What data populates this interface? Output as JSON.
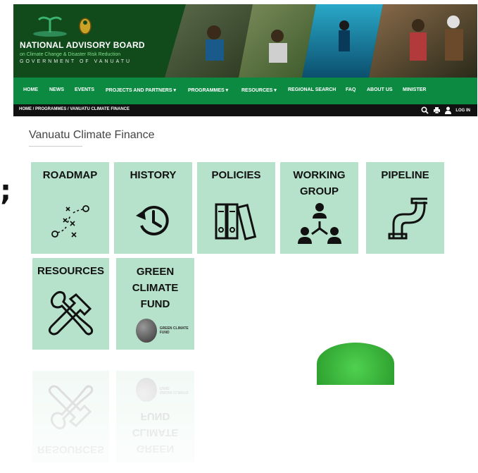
{
  "header": {
    "org_title": "NATIONAL ADVISORY BOARD",
    "org_subtitle": "on Climate Change & Disaster Risk Reduction",
    "org_gov": "GOVERNMENT OF VANUATU"
  },
  "nav": {
    "items": [
      {
        "label": "HOME"
      },
      {
        "label": "NEWS"
      },
      {
        "label": "EVENTS"
      },
      {
        "label": "PROJECTS AND PARTNERS ▾"
      },
      {
        "label": "PROGRAMMES ▾"
      },
      {
        "label": "RESOURCES ▾"
      },
      {
        "label": "REGIONAL SEARCH"
      },
      {
        "label": "FAQ"
      },
      {
        "label": "ABOUT US"
      },
      {
        "label": "MINISTER"
      }
    ]
  },
  "breadcrumb": {
    "text": "HOME / PROGRAMMES / VANUATU CLIMATE FINANCE",
    "login_label": "LOG IN"
  },
  "page": {
    "title": "Vanuatu Climate Finance"
  },
  "tiles": [
    {
      "label": "ROADMAP",
      "icon": "roadmap-icon"
    },
    {
      "label": "HISTORY",
      "icon": "history-icon"
    },
    {
      "label": "POLICIES",
      "icon": "binders-icon"
    },
    {
      "label": "WORKING GROUP",
      "icon": "group-icon"
    },
    {
      "label": "PIPELINE",
      "icon": "pipe-icon"
    },
    {
      "label": "RESOURCES",
      "icon": "tools-icon"
    },
    {
      "label": "GREEN CLIMATE FUND",
      "icon": "gcf-logo"
    }
  ],
  "gcf_logo_text": "GREEN CLIMATE FUND",
  "stray_glyph": ";",
  "colors": {
    "header_bg": "#114a1b",
    "nav_bg": "#0d8a42",
    "tile_bg": "#b6e2cb",
    "breadcrumb_bg": "#111111"
  }
}
